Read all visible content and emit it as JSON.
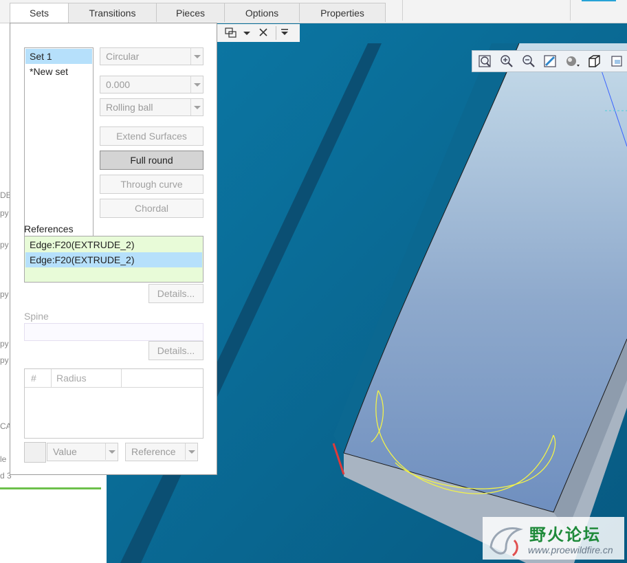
{
  "tabs": [
    "Sets",
    "Transitions",
    "Pieces",
    "Options",
    "Properties"
  ],
  "active_tab": "Sets",
  "sets_list": [
    "Set 1",
    "*New set"
  ],
  "selected_set": "Set 1",
  "shape_combo": "Circular",
  "value_combo": "0.000",
  "method_combo": "Rolling ball",
  "buttons": {
    "extend_surfaces": "Extend Surfaces",
    "full_round": "Full round",
    "through_curve": "Through curve",
    "chordal": "Chordal"
  },
  "references_label": "References",
  "references": [
    "Edge:F20(EXTRUDE_2)",
    "Edge:F20(EXTRUDE_2)"
  ],
  "details_label": "Details...",
  "spine_label": "Spine",
  "radius_table": {
    "headers": [
      "#",
      "Radius"
    ]
  },
  "value_combo_bottom": "Value",
  "reference_combo_bottom": "Reference",
  "left_fragments": [
    "DE",
    "py",
    "py",
    "py",
    "py",
    "py",
    "CA",
    "le",
    "d 3"
  ],
  "watermark": {
    "title": "野火论坛",
    "url": "www.proewildfire.cn"
  },
  "colors": {
    "viewport_bg": "#0a6a93",
    "selection": "#b6e0fb",
    "reference_bg": "#e8fbd8",
    "green_bar": "#6cc04a"
  }
}
